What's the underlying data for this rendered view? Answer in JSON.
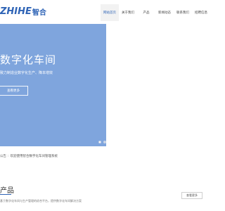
{
  "header": {
    "logo_text": "ZHIHE",
    "logo_cn": "智合",
    "nav": [
      {
        "label": "网站首页"
      },
      {
        "label": "关于我们"
      },
      {
        "label": "产品"
      },
      {
        "label": "新闻动态"
      },
      {
        "label": "联系我们"
      },
      {
        "label": "招聘信息"
      }
    ]
  },
  "hero": {
    "title": "数字化车间",
    "subtitle": "致力制造业数字化生产、降本增效",
    "button_label": "查看更多"
  },
  "breadcrumb": {
    "prefix": "公告",
    "separator": ":",
    "text": "欢迎使用智合数字化车间管理系统"
  },
  "products": {
    "title": "产品",
    "description": "基于数字化车间与生产管理的综合平台，提供数字化车间解决方案",
    "more_label": "查看更多"
  }
}
